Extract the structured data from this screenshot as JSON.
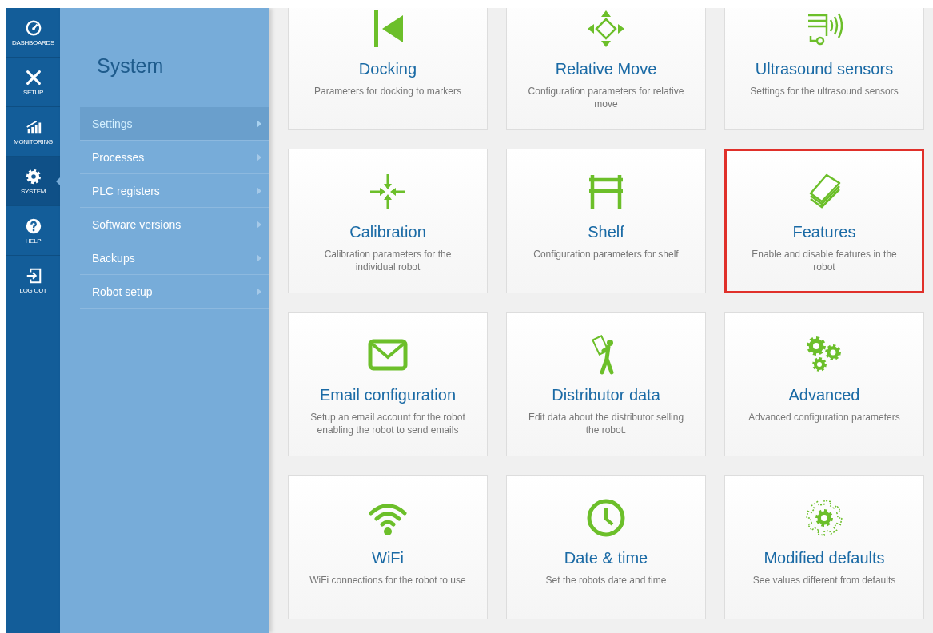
{
  "nav_rail": [
    {
      "label": "DASHBOARDS",
      "kind": "gauge",
      "selected": false
    },
    {
      "label": "SETUP",
      "kind": "tools",
      "selected": false
    },
    {
      "label": "MONITORING",
      "kind": "chart",
      "selected": false
    },
    {
      "label": "SYSTEM",
      "kind": "gear",
      "selected": true
    },
    {
      "label": "HELP",
      "kind": "help",
      "selected": false
    },
    {
      "label": "LOG OUT",
      "kind": "logout",
      "selected": false
    }
  ],
  "submenu": {
    "title": "System",
    "items": [
      {
        "label": "Settings",
        "selected": true
      },
      {
        "label": "Processes",
        "selected": false
      },
      {
        "label": "PLC registers",
        "selected": false
      },
      {
        "label": "Software versions",
        "selected": false
      },
      {
        "label": "Backups",
        "selected": false
      },
      {
        "label": "Robot setup",
        "selected": false
      }
    ]
  },
  "tiles": [
    {
      "kind": "docking",
      "title": "Docking",
      "description": "Parameters for docking to markers",
      "highlighted": false
    },
    {
      "kind": "move",
      "title": "Relative Move",
      "description": "Configuration parameters for relative move",
      "highlighted": false
    },
    {
      "kind": "ultrasound",
      "title": "Ultrasound sensors",
      "description": "Settings for the ultrasound sensors",
      "highlighted": false
    },
    {
      "kind": "calibration",
      "title": "Calibration",
      "description": "Calibration parameters for the individual robot",
      "highlighted": false
    },
    {
      "kind": "shelf",
      "title": "Shelf",
      "description": "Configuration parameters for shelf",
      "highlighted": false
    },
    {
      "kind": "features",
      "title": "Features",
      "description": "Enable and disable features in the robot",
      "highlighted": true
    },
    {
      "kind": "email",
      "title": "Email configuration",
      "description": "Setup an email account for the robot enabling the robot to send emails",
      "highlighted": false
    },
    {
      "kind": "distributor",
      "title": "Distributor data",
      "description": "Edit data about the distributor selling the robot.",
      "highlighted": false
    },
    {
      "kind": "advanced",
      "title": "Advanced",
      "description": "Advanced configuration parameters",
      "highlighted": false
    },
    {
      "kind": "wifi",
      "title": "WiFi",
      "description": "WiFi connections for the robot to use",
      "highlighted": false
    },
    {
      "kind": "clock",
      "title": "Date & time",
      "description": "Set the robots date and time",
      "highlighted": false
    },
    {
      "kind": "defaults",
      "title": "Modified defaults",
      "description": "See values different from defaults",
      "highlighted": false
    }
  ]
}
